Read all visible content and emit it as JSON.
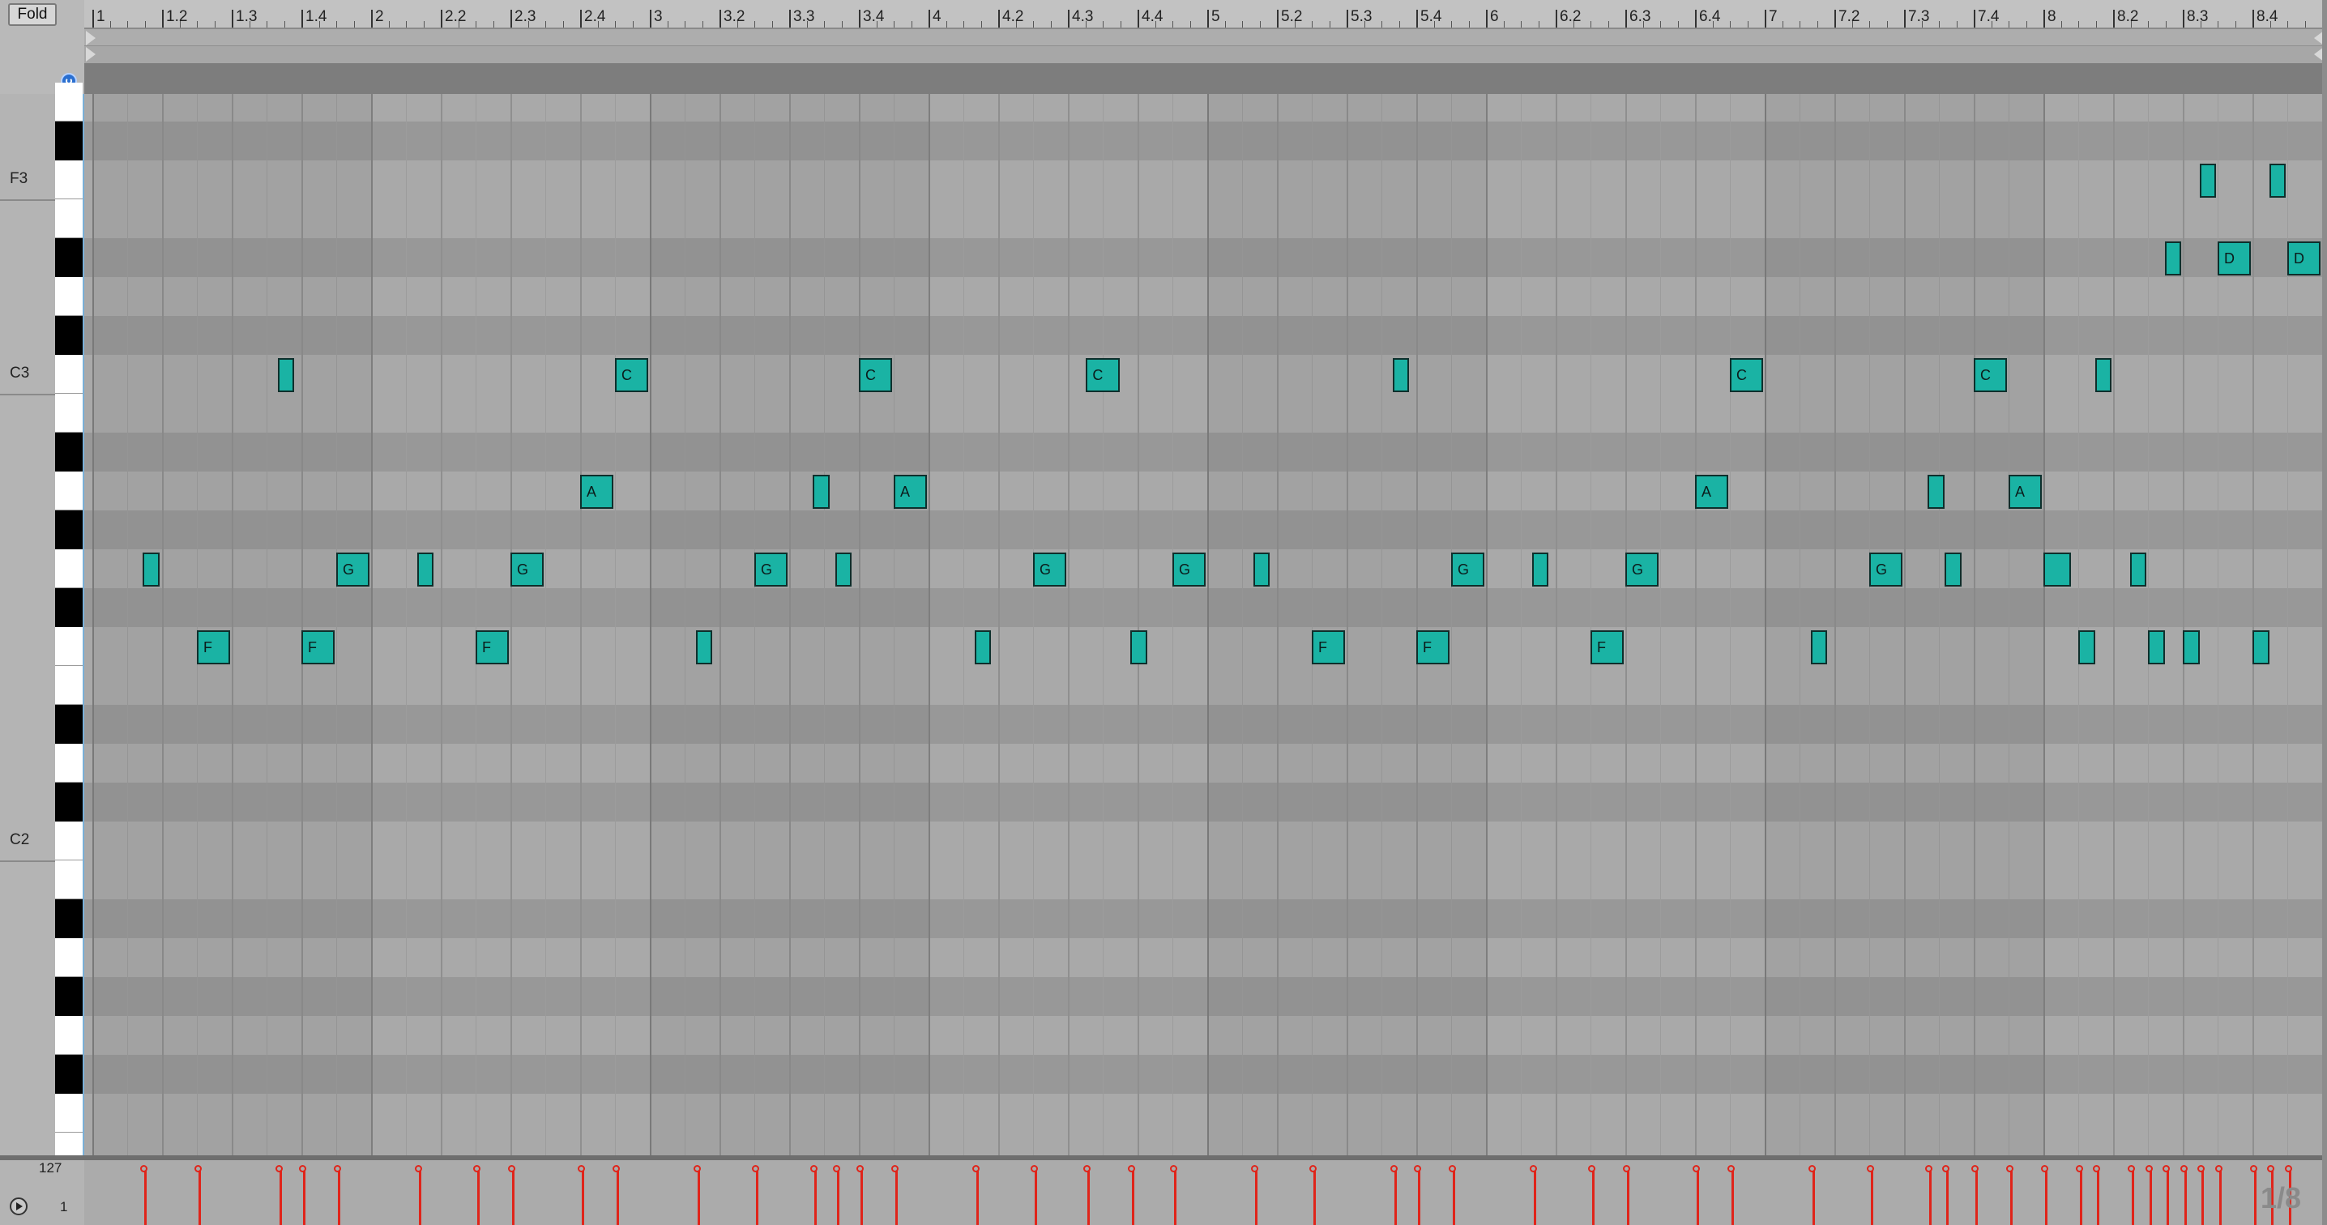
{
  "header": {
    "fold_label": "Fold"
  },
  "ruler": {
    "labels": [
      "1",
      "1.2",
      "1.3",
      "1.4",
      "2",
      "2.2",
      "2.3",
      "2.4",
      "3",
      "3.2",
      "3.3",
      "3.4",
      "4",
      "4.2",
      "4.3",
      "4.4",
      "5",
      "5.2",
      "5.3",
      "5.4",
      "6",
      "6.2",
      "6.3",
      "6.4",
      "7",
      "7.2",
      "7.3",
      "7.4",
      "8",
      "8.2",
      "8.3",
      "8.4"
    ]
  },
  "keyboard": {
    "octave_labels": [
      "F3",
      "C3",
      "C2"
    ]
  },
  "notes": [
    {
      "bar": 1.18,
      "len": 0.06,
      "pitch": "G2",
      "label": ""
    },
    {
      "bar": 1.375,
      "len": 0.12,
      "pitch": "F2",
      "label": "F"
    },
    {
      "bar": 1.665,
      "len": 0.06,
      "pitch": "C3",
      "label": ""
    },
    {
      "bar": 1.75,
      "len": 0.12,
      "pitch": "F2",
      "label": "F"
    },
    {
      "bar": 1.875,
      "len": 0.12,
      "pitch": "G2",
      "label": "G"
    },
    {
      "bar": 2.165,
      "len": 0.06,
      "pitch": "G2",
      "label": ""
    },
    {
      "bar": 2.375,
      "len": 0.12,
      "pitch": "F2",
      "label": "F"
    },
    {
      "bar": 2.5,
      "len": 0.12,
      "pitch": "G2",
      "label": "G"
    },
    {
      "bar": 2.75,
      "len": 0.12,
      "pitch": "A2",
      "label": "A"
    },
    {
      "bar": 2.875,
      "len": 0.12,
      "pitch": "C3",
      "label": "C"
    },
    {
      "bar": 3.165,
      "len": 0.06,
      "pitch": "F2",
      "label": ""
    },
    {
      "bar": 3.375,
      "len": 0.12,
      "pitch": "G2",
      "label": "G"
    },
    {
      "bar": 3.585,
      "len": 0.06,
      "pitch": "A2",
      "label": ""
    },
    {
      "bar": 3.665,
      "len": 0.06,
      "pitch": "G2",
      "label": ""
    },
    {
      "bar": 3.75,
      "len": 0.12,
      "pitch": "C3",
      "label": "C"
    },
    {
      "bar": 3.875,
      "len": 0.12,
      "pitch": "A2",
      "label": "A"
    },
    {
      "bar": 4.165,
      "len": 0.06,
      "pitch": "F2",
      "label": ""
    },
    {
      "bar": 4.375,
      "len": 0.12,
      "pitch": "G2",
      "label": "G"
    },
    {
      "bar": 4.565,
      "len": 0.12,
      "pitch": "C3",
      "label": "C"
    },
    {
      "bar": 4.725,
      "len": 0.06,
      "pitch": "F2",
      "label": ""
    },
    {
      "bar": 4.875,
      "len": 0.12,
      "pitch": "G2",
      "label": "G"
    },
    {
      "bar": 5.165,
      "len": 0.06,
      "pitch": "G2",
      "label": ""
    },
    {
      "bar": 5.375,
      "len": 0.12,
      "pitch": "F2",
      "label": "F"
    },
    {
      "bar": 5.665,
      "len": 0.06,
      "pitch": "C3",
      "label": ""
    },
    {
      "bar": 5.75,
      "len": 0.12,
      "pitch": "F2",
      "label": "F"
    },
    {
      "bar": 5.875,
      "len": 0.12,
      "pitch": "G2",
      "label": "G"
    },
    {
      "bar": 6.165,
      "len": 0.06,
      "pitch": "G2",
      "label": ""
    },
    {
      "bar": 6.375,
      "len": 0.12,
      "pitch": "F2",
      "label": "F"
    },
    {
      "bar": 6.5,
      "len": 0.12,
      "pitch": "G2",
      "label": "G"
    },
    {
      "bar": 6.75,
      "len": 0.12,
      "pitch": "A2",
      "label": "A"
    },
    {
      "bar": 6.875,
      "len": 0.12,
      "pitch": "C3",
      "label": "C"
    },
    {
      "bar": 7.165,
      "len": 0.06,
      "pitch": "F2",
      "label": ""
    },
    {
      "bar": 7.375,
      "len": 0.12,
      "pitch": "G2",
      "label": "G"
    },
    {
      "bar": 7.585,
      "len": 0.06,
      "pitch": "A2",
      "label": ""
    },
    {
      "bar": 7.645,
      "len": 0.06,
      "pitch": "G2",
      "label": ""
    },
    {
      "bar": 7.75,
      "len": 0.12,
      "pitch": "C3",
      "label": "C"
    },
    {
      "bar": 7.875,
      "len": 0.12,
      "pitch": "A2",
      "label": "A"
    },
    {
      "bar": 8.0,
      "len": 0.1,
      "pitch": "G2",
      "label": ""
    },
    {
      "bar": 8.125,
      "len": 0.06,
      "pitch": "F2",
      "label": ""
    },
    {
      "bar": 8.185,
      "len": 0.06,
      "pitch": "C3",
      "label": ""
    },
    {
      "bar": 8.31,
      "len": 0.06,
      "pitch": "G2",
      "label": ""
    },
    {
      "bar": 8.375,
      "len": 0.06,
      "pitch": "F2",
      "label": ""
    },
    {
      "bar": 8.435,
      "len": 0.06,
      "pitch": "D#3",
      "label": ""
    },
    {
      "bar": 8.5,
      "len": 0.06,
      "pitch": "F2",
      "label": ""
    },
    {
      "bar": 8.56,
      "len": 0.06,
      "pitch": "F3",
      "label": ""
    },
    {
      "bar": 8.625,
      "len": 0.12,
      "pitch": "D#3",
      "label": "D"
    },
    {
      "bar": 8.75,
      "len": 0.06,
      "pitch": "F2",
      "label": ""
    },
    {
      "bar": 8.81,
      "len": 0.06,
      "pitch": "F3",
      "label": ""
    },
    {
      "bar": 8.875,
      "len": 0.12,
      "pitch": "D#3",
      "label": "D"
    }
  ],
  "velocity": {
    "max_label": "127",
    "min_label": "1",
    "grid_label": "1/8"
  },
  "colors": {
    "note": "#1ab3a4",
    "velocity": "#e0241a"
  }
}
